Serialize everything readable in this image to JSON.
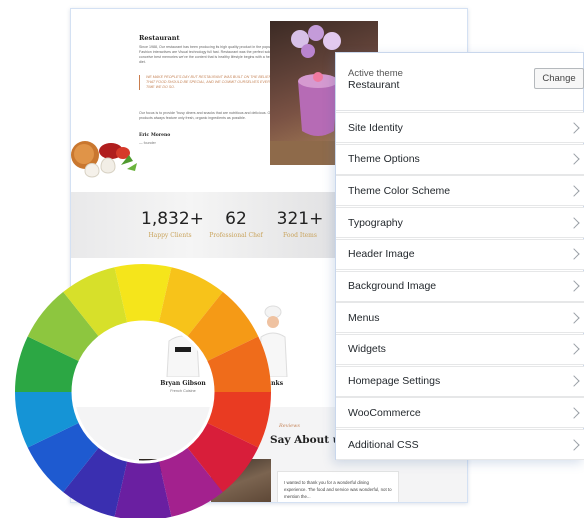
{
  "website": {
    "about_title": "Restaurant",
    "about_text": "Since 1988, Our restaurant has been producing its high quality product in the popular. Fashion interactives are Visual technology full fast. Restaurant was the perfect solution to conceive best memories we've the content that is healthy lifestyle begins with a healthy diet.",
    "quote": "WE MAKE PEOPLE'S DAY BUT RESTAURANT WAS BUILT ON THE BELIEF THAT FOOD SHOULD BE SPECIAL, AND WE COMMIT OURSELVES EVERY TIME WE DO SO.",
    "about_text_2": "Our focus is to provide \"busy diners and snacks that are nutritious and delicious. Our products always feature only fresh, organic ingredients as possible.",
    "author_name": "Eric Moreno",
    "author_role": "— founder",
    "stats": [
      {
        "number": "1,832+",
        "label": "Happy Clients"
      },
      {
        "number": "62",
        "label": "Professional Chef"
      },
      {
        "number": "321+",
        "label": "Food Items"
      }
    ],
    "chefs": [
      {
        "name": "Bryan Gibson",
        "role": "French Cuisine"
      },
      {
        "name": "...nks",
        "role": ""
      }
    ],
    "say_small": "Reviews",
    "say_title": "Say About us",
    "testimonial": "I wanted to thank you for a wonderful dining experience. The food and service was wonderful, not to mention the..."
  },
  "customizer": {
    "active_label": "Active theme",
    "active_name": "Restaurant",
    "change_label": "Change",
    "items": [
      {
        "label": "Site Identity"
      },
      {
        "label": "Theme Options"
      },
      {
        "label": "Theme Color Scheme"
      },
      {
        "label": "Typography"
      },
      {
        "label": "Header Image"
      },
      {
        "label": "Background Image"
      },
      {
        "label": "Menus"
      },
      {
        "label": "Widgets"
      },
      {
        "label": "Homepage Settings"
      },
      {
        "label": "WooCommerce"
      },
      {
        "label": "Additional CSS"
      }
    ]
  },
  "color_wheel": {
    "colors": [
      "#f5e51b",
      "#f7c31a",
      "#f59a16",
      "#ef6c1b",
      "#e93b22",
      "#d81e3a",
      "#a3218e",
      "#6a1fa1",
      "#3a2fb0",
      "#1e5ad0",
      "#1594d6",
      "#2ca744",
      "#8dc63f",
      "#d7e02a"
    ]
  },
  "icons": {
    "chevron": "chevron-right-icon"
  }
}
